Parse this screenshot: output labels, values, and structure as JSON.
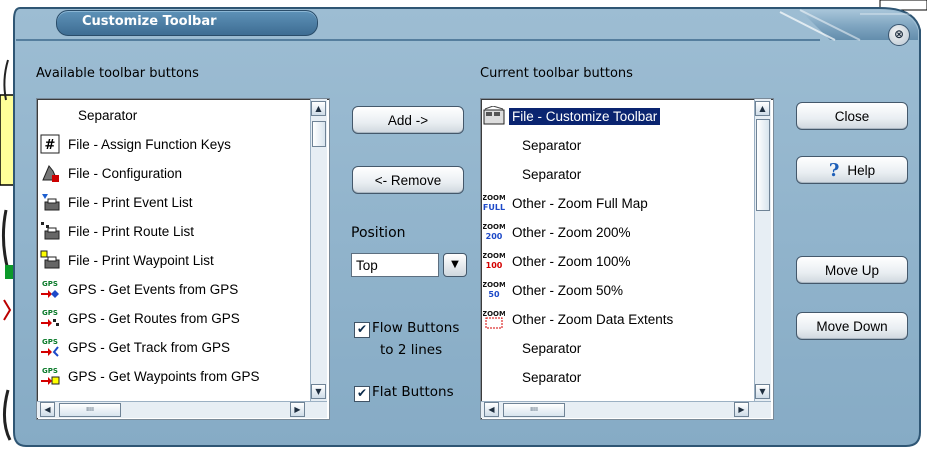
{
  "dialog": {
    "title": "Customize Toolbar",
    "close_glyph": "⊗"
  },
  "available": {
    "label": "Available toolbar buttons",
    "items": [
      {
        "label": "Separator",
        "icon": "none"
      },
      {
        "label": "File - Assign Function Keys",
        "icon": "function-keys-icon"
      },
      {
        "label": "File - Configuration",
        "icon": "configuration-icon"
      },
      {
        "label": "File - Print Event List",
        "icon": "print-event-icon"
      },
      {
        "label": "File - Print Route List",
        "icon": "print-route-icon"
      },
      {
        "label": "File - Print Waypoint List",
        "icon": "print-waypoint-icon"
      },
      {
        "label": "GPS - Get Events from GPS",
        "icon": "gps-events-icon"
      },
      {
        "label": "GPS - Get Routes from GPS",
        "icon": "gps-routes-icon"
      },
      {
        "label": "GPS - Get Track from GPS",
        "icon": "gps-track-icon"
      },
      {
        "label": "GPS - Get Waypoints from GPS",
        "icon": "gps-waypoints-icon"
      }
    ]
  },
  "current": {
    "label": "Current toolbar buttons",
    "items": [
      {
        "label": "File - Customize Toolbar",
        "icon": "customize-toolbar-icon",
        "selected": true
      },
      {
        "label": "Separator",
        "icon": "none"
      },
      {
        "label": "Separator",
        "icon": "none"
      },
      {
        "label": "Other - Zoom Full Map",
        "icon": "zoom-full-icon",
        "badge": "FULL"
      },
      {
        "label": "Other - Zoom 200%",
        "icon": "zoom-200-icon",
        "badge": "200"
      },
      {
        "label": "Other - Zoom 100%",
        "icon": "zoom-100-icon",
        "badge": "100"
      },
      {
        "label": "Other - Zoom 50%",
        "icon": "zoom-50-icon",
        "badge": "50"
      },
      {
        "label": "Other - Zoom Data Extents",
        "icon": "zoom-extents-icon",
        "badge": ""
      },
      {
        "label": "Separator",
        "icon": "none"
      },
      {
        "label": "Separator",
        "icon": "none"
      }
    ]
  },
  "buttons": {
    "add": "Add ->",
    "remove": "<- Remove",
    "close": "Close",
    "help": "Help",
    "move_up": "Move Up",
    "move_down": "Move Down"
  },
  "position": {
    "label": "Position",
    "value": "Top"
  },
  "options": {
    "flow_line1": "Flow Buttons",
    "flow_line2": "to 2 lines",
    "flow_checked": true,
    "flat": "Flat Buttons",
    "flat_checked": true
  },
  "colors": {
    "dialog_bg": "#8fb3cc",
    "frame": "#2f5674",
    "selection": "#0a2470"
  }
}
